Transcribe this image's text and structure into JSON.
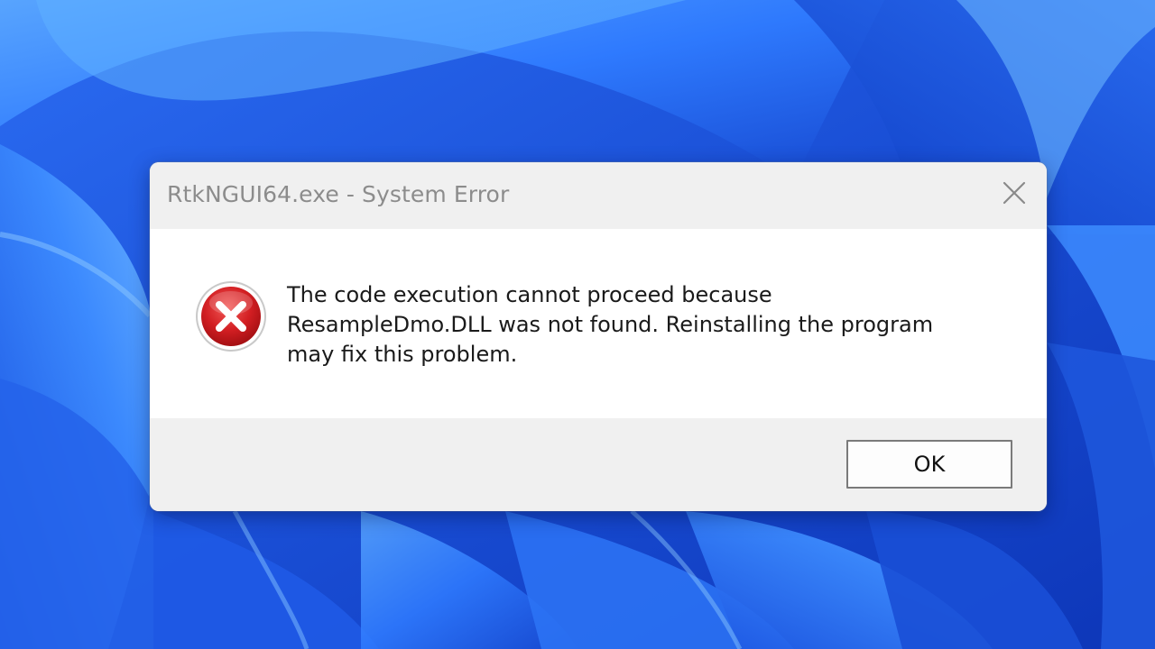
{
  "dialog": {
    "title": "RtkNGUI64.exe - System Error",
    "close_icon": "close-icon",
    "status_icon": "error-icon",
    "message_lines": [
      "The code execution cannot proceed because",
      "ResampleDmo.DLL was not found. Reinstalling the program",
      "may fix this problem."
    ],
    "ok_label": "OK"
  },
  "colors": {
    "accent_error": "#c8161d",
    "desktop_blue": "#1a4fd0",
    "dialog_bg": "#f0f0f0",
    "content_bg": "#ffffff"
  }
}
